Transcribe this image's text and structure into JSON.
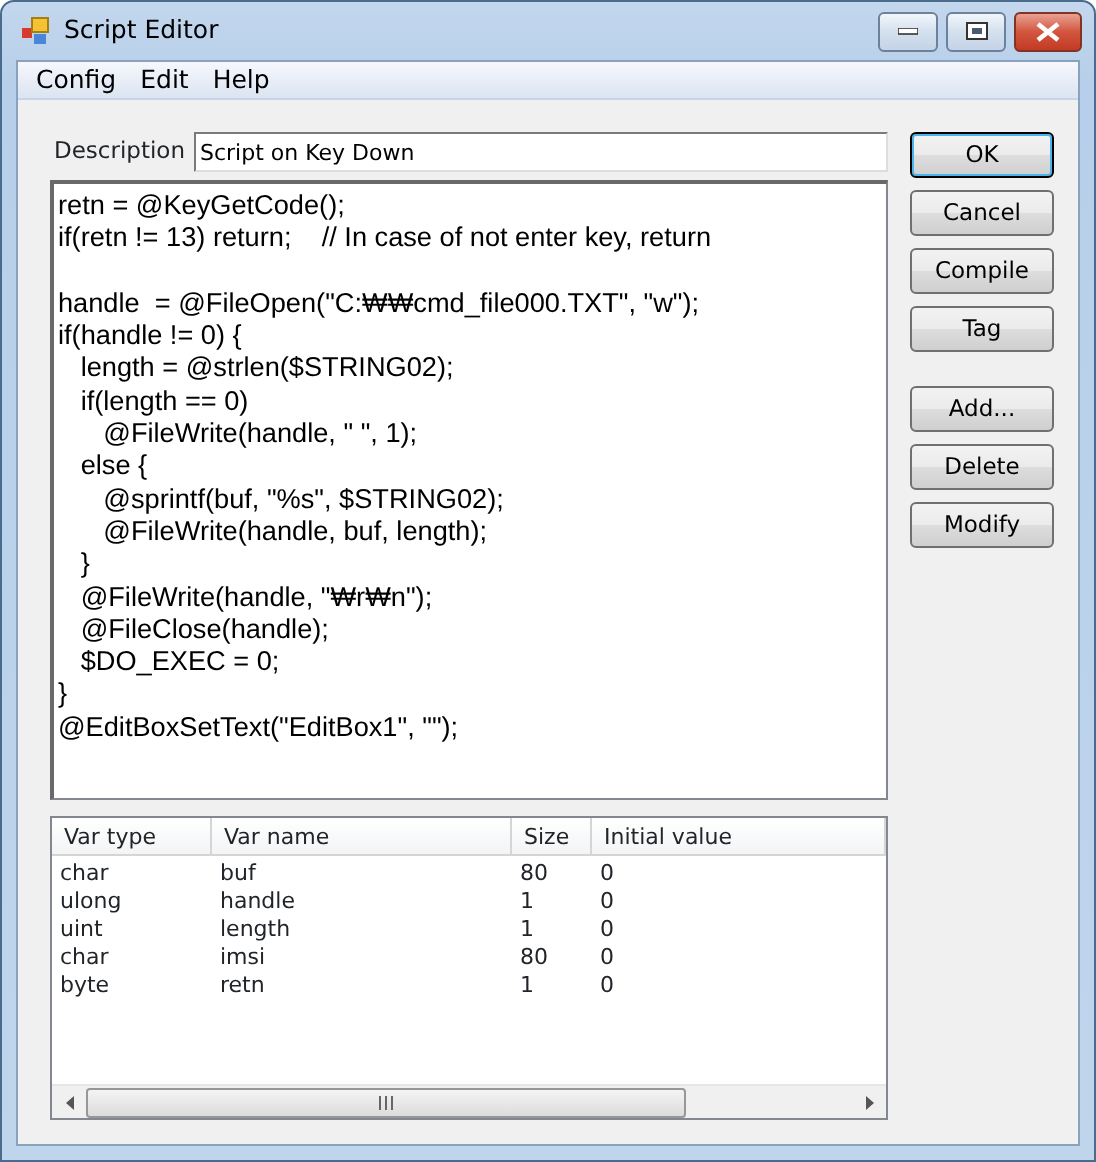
{
  "window": {
    "title": "Script Editor"
  },
  "menu": [
    "Config",
    "Edit",
    "Help"
  ],
  "description": {
    "label": "Description",
    "value": "Script on Key Down"
  },
  "code": "retn = @KeyGetCode();\nif(retn != 13) return;    // In case of not enter key, return\n\nhandle  = @FileOpen(\"C:₩₩cmd_file000.TXT\", \"w\");\nif(handle != 0) {\n   length = @strlen($STRING02);\n   if(length == 0)\n      @FileWrite(handle, \" \", 1);\n   else {\n      @sprintf(buf, \"%s\", $STRING02);\n      @FileWrite(handle, buf, length);\n   }\n   @FileWrite(handle, \"₩r₩n\");\n   @FileClose(handle);\n   $DO_EXEC = 0;\n}\n@EditBoxSetText(\"EditBox1\", \"\");",
  "variables": {
    "columns": [
      "Var type",
      "Var name",
      "Size",
      "Initial value"
    ],
    "rows": [
      [
        "char",
        "buf",
        "80",
        "0"
      ],
      [
        "ulong",
        "handle",
        "1",
        "0"
      ],
      [
        "uint",
        "length",
        "1",
        "0"
      ],
      [
        "char",
        "imsi",
        "80",
        "0"
      ],
      [
        "byte",
        "retn",
        "1",
        "0"
      ]
    ]
  },
  "button_groups": [
    [
      {
        "label": "OK",
        "default": true
      },
      {
        "label": "Cancel",
        "default": false
      },
      {
        "label": "Compile",
        "default": false
      },
      {
        "label": "Tag",
        "default": false
      }
    ],
    [
      {
        "label": "Add...",
        "default": false
      },
      {
        "label": "Delete",
        "default": false
      },
      {
        "label": "Modify",
        "default": false
      }
    ]
  ]
}
